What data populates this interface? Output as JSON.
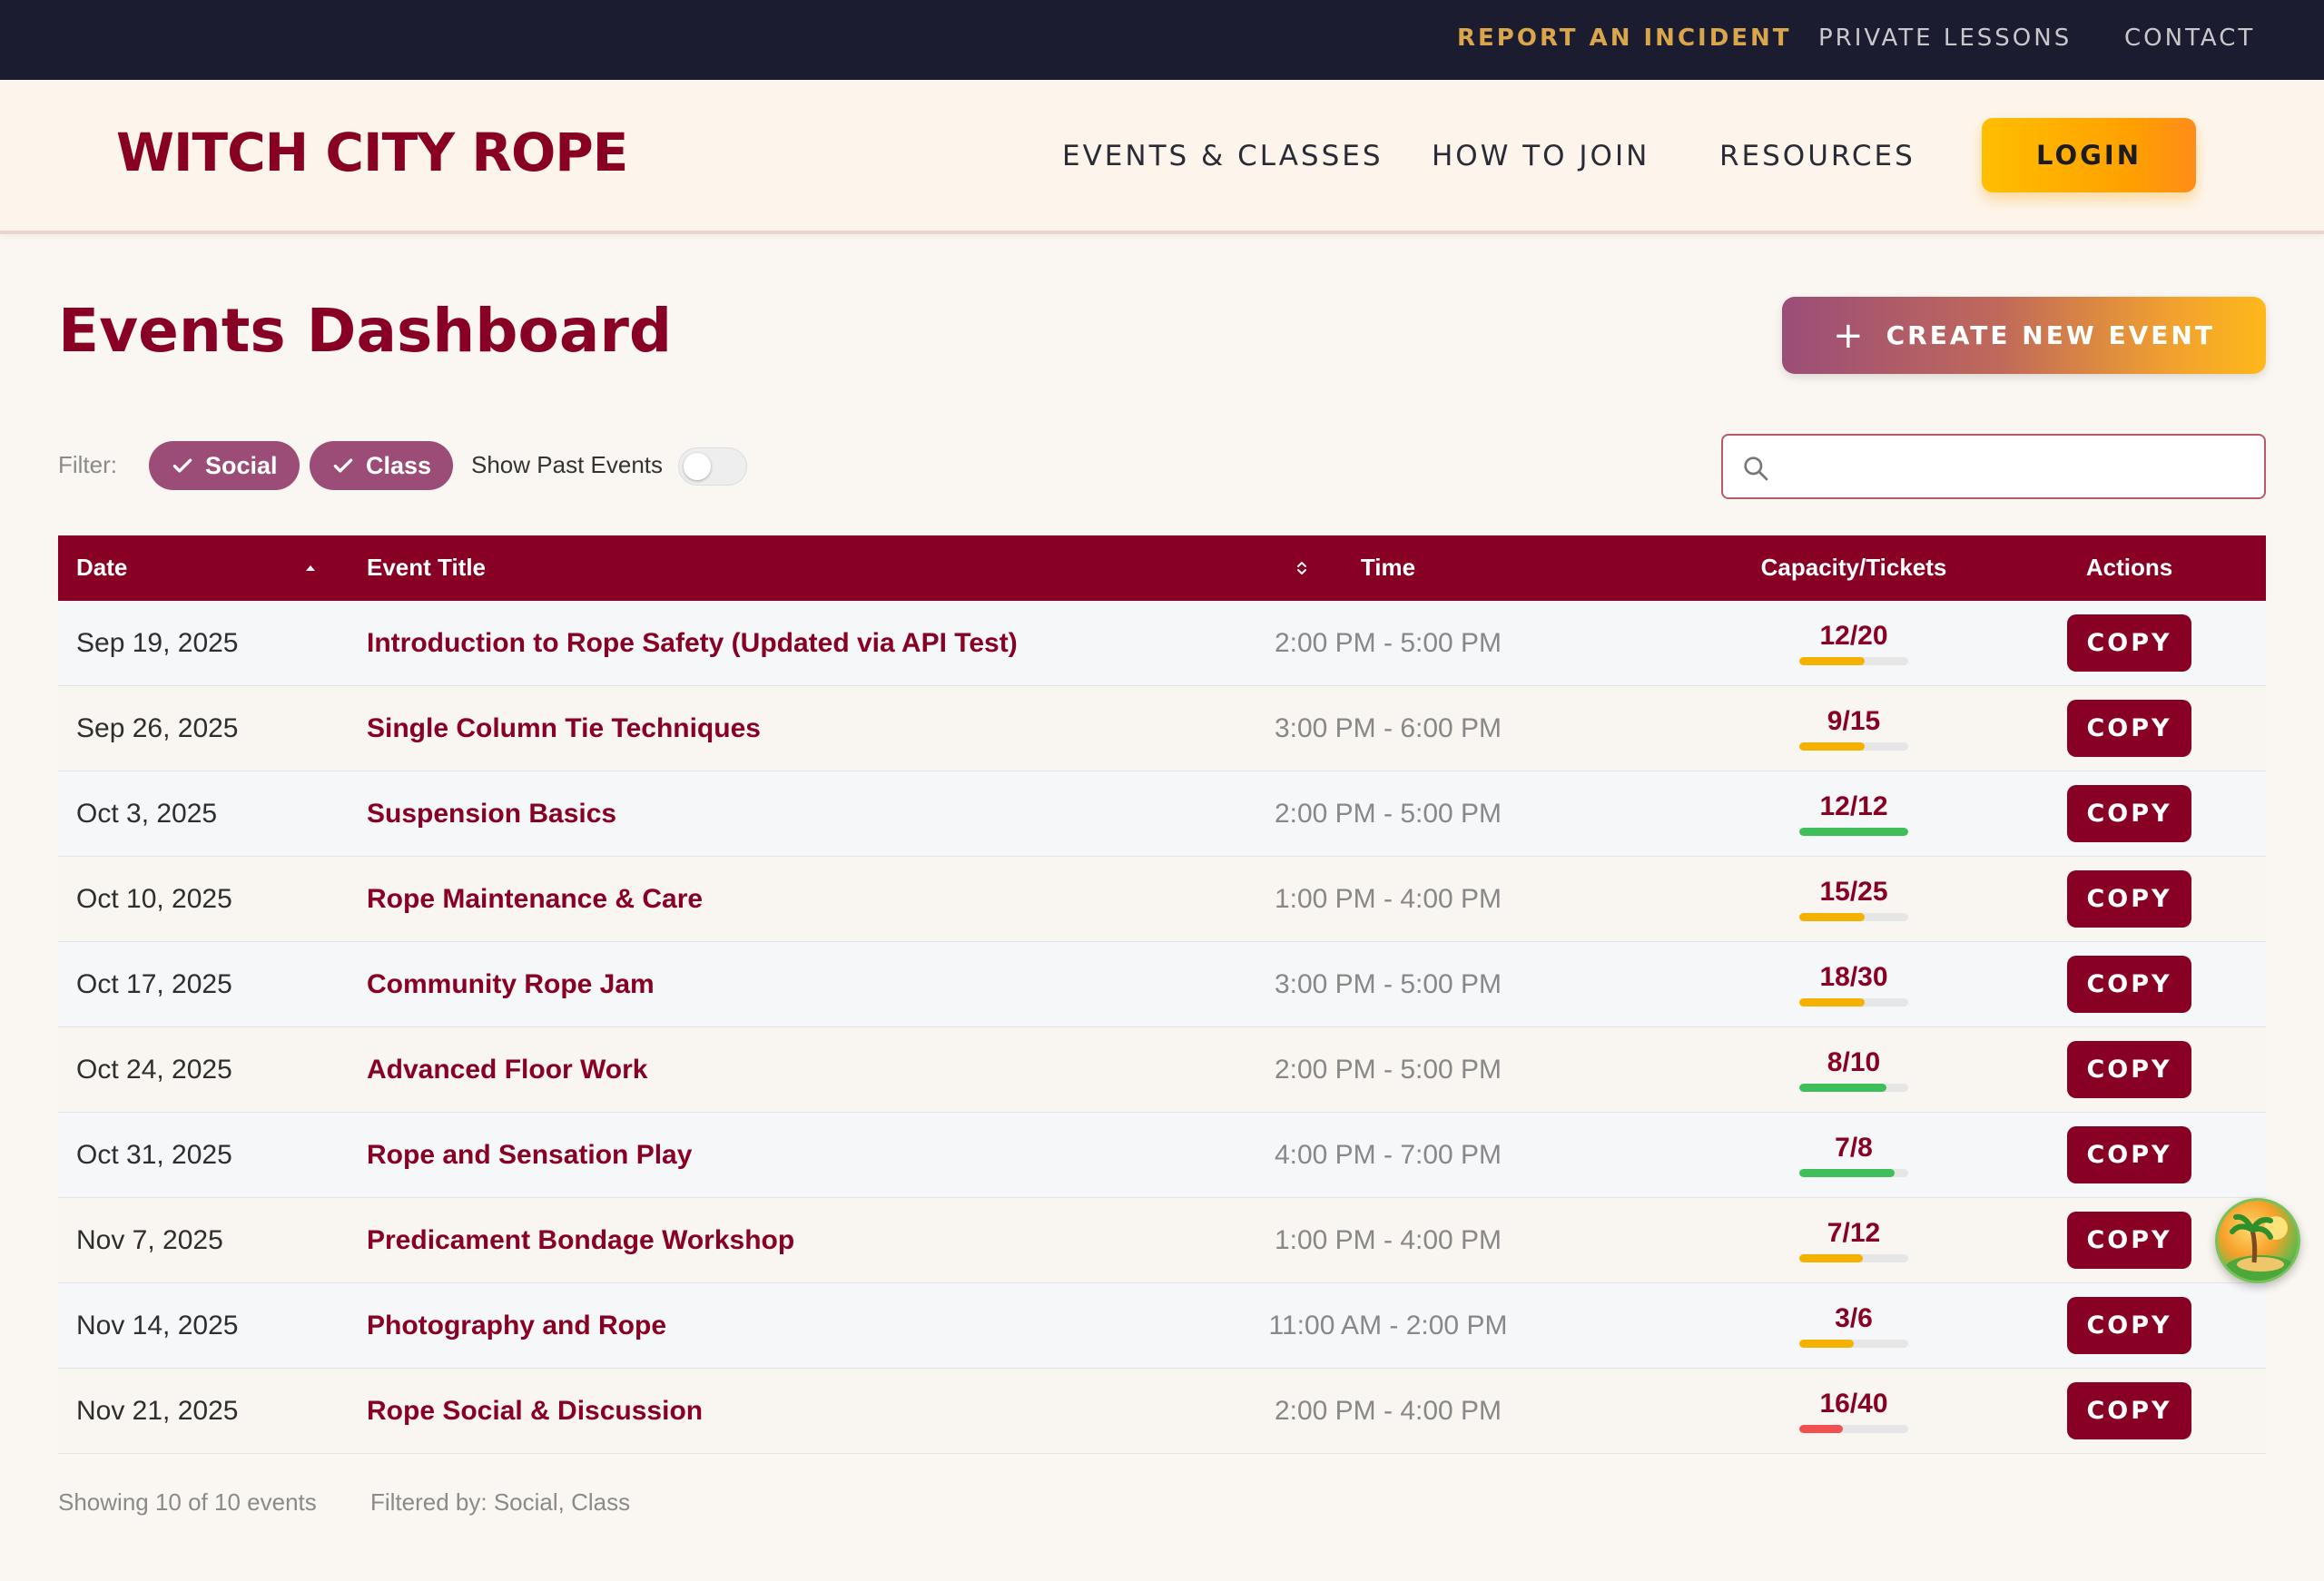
{
  "top_nav": {
    "report_incident": "REPORT AN INCIDENT",
    "private_lessons": "PRIVATE LESSONS",
    "contact": "CONTACT"
  },
  "header": {
    "logo": "WITCH CITY ROPE",
    "nav": [
      "EVENTS & CLASSES",
      "HOW TO JOIN",
      "RESOURCES"
    ],
    "login": "LOGIN"
  },
  "page": {
    "title": "Events Dashboard",
    "create_button": "CREATE NEW EVENT"
  },
  "filters": {
    "label": "Filter:",
    "chips": [
      "Social",
      "Class"
    ],
    "show_past_label": "Show Past Events",
    "show_past_enabled": false
  },
  "search": {
    "placeholder": "",
    "value": ""
  },
  "table": {
    "columns": {
      "date": "Date",
      "title": "Event Title",
      "time": "Time",
      "capacity": "Capacity/Tickets",
      "actions": "Actions"
    },
    "copy_label": "COPY",
    "rows": [
      {
        "date": "Sep 19, 2025",
        "title": "Introduction to Rope Safety (Updated via API Test)",
        "time": "2:00 PM - 5:00 PM",
        "capacity": "12/20",
        "fill": 0.6,
        "color": "#f5b100"
      },
      {
        "date": "Sep 26, 2025",
        "title": "Single Column Tie Techniques",
        "time": "3:00 PM - 6:00 PM",
        "capacity": "9/15",
        "fill": 0.6,
        "color": "#f5b100"
      },
      {
        "date": "Oct 3, 2025",
        "title": "Suspension Basics",
        "time": "2:00 PM - 5:00 PM",
        "capacity": "12/12",
        "fill": 1.0,
        "color": "#3fbf5a"
      },
      {
        "date": "Oct 10, 2025",
        "title": "Rope Maintenance & Care",
        "time": "1:00 PM - 4:00 PM",
        "capacity": "15/25",
        "fill": 0.6,
        "color": "#f5b100"
      },
      {
        "date": "Oct 17, 2025",
        "title": "Community Rope Jam",
        "time": "3:00 PM - 5:00 PM",
        "capacity": "18/30",
        "fill": 0.6,
        "color": "#f5b100"
      },
      {
        "date": "Oct 24, 2025",
        "title": "Advanced Floor Work",
        "time": "2:00 PM - 5:00 PM",
        "capacity": "8/10",
        "fill": 0.8,
        "color": "#3fbf5a"
      },
      {
        "date": "Oct 31, 2025",
        "title": "Rope and Sensation Play",
        "time": "4:00 PM - 7:00 PM",
        "capacity": "7/8",
        "fill": 0.875,
        "color": "#3fbf5a"
      },
      {
        "date": "Nov 7, 2025",
        "title": "Predicament Bondage Workshop",
        "time": "1:00 PM - 4:00 PM",
        "capacity": "7/12",
        "fill": 0.583,
        "color": "#f5b100"
      },
      {
        "date": "Nov 14, 2025",
        "title": "Photography and Rope",
        "time": "11:00 AM - 2:00 PM",
        "capacity": "3/6",
        "fill": 0.5,
        "color": "#f5b100"
      },
      {
        "date": "Nov 21, 2025",
        "title": "Rope Social & Discussion",
        "time": "2:00 PM - 4:00 PM",
        "capacity": "16/40",
        "fill": 0.4,
        "color": "#f05050"
      }
    ]
  },
  "footer": {
    "showing": "Showing 10 of 10 events",
    "filtered_by": "Filtered by: Social, Class"
  },
  "colors": {
    "brand": "#880124",
    "accent": "#ffbf00",
    "chip": "#9b4d78"
  }
}
